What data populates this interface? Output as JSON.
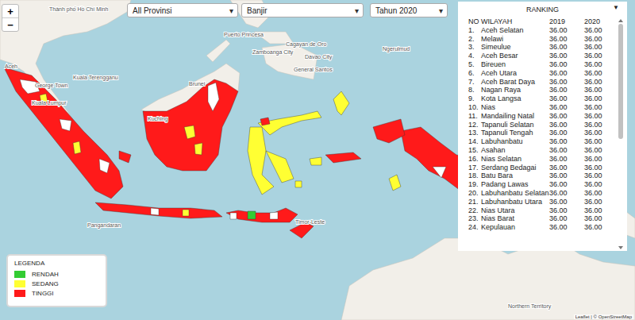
{
  "zoom": [
    "+",
    "−"
  ],
  "filters": [
    {
      "label": "All Provinsi",
      "caret": "▾"
    },
    {
      "label": "Banjir",
      "caret": "▾"
    },
    {
      "label": "Tahun 2020",
      "caret": "▾"
    }
  ],
  "ranking": {
    "title": "RANKING",
    "toggle": "▼",
    "columns": [
      "NO",
      "WILAYAH",
      "2019",
      "2020"
    ],
    "scroll": {
      "level": 0.5
    },
    "rows": [
      {
        "no": "1.",
        "name": "Aceh Selatan",
        "y2019": "36.00",
        "y2020": "36.00"
      },
      {
        "no": "2.",
        "name": "Melawi",
        "y2019": "36.00",
        "y2020": "36.00"
      },
      {
        "no": "3.",
        "name": "Simeulue",
        "y2019": "36.00",
        "y2020": "36.00"
      },
      {
        "no": "4.",
        "name": "Aceh Besar",
        "y2019": "36.00",
        "y2020": "36.00"
      },
      {
        "no": "5.",
        "name": "Bireuen",
        "y2019": "36.00",
        "y2020": "36.00"
      },
      {
        "no": "6.",
        "name": "Aceh Utara",
        "y2019": "36.00",
        "y2020": "36.00"
      },
      {
        "no": "7.",
        "name": "Aceh Barat Daya",
        "y2019": "36.00",
        "y2020": "36.00"
      },
      {
        "no": "8.",
        "name": "Nagan Raya",
        "y2019": "36.00",
        "y2020": "36.00"
      },
      {
        "no": "9.",
        "name": "Kota Langsa",
        "y2019": "36.00",
        "y2020": "36.00"
      },
      {
        "no": "10.",
        "name": "Nias",
        "y2019": "36.00",
        "y2020": "36.00"
      },
      {
        "no": "11.",
        "name": "Mandailing Natal",
        "y2019": "36.00",
        "y2020": "36.00"
      },
      {
        "no": "12.",
        "name": "Tapanuli Selatan",
        "y2019": "36.00",
        "y2020": "36.00"
      },
      {
        "no": "13.",
        "name": "Tapanuli Tengah",
        "y2019": "36.00",
        "y2020": "36.00"
      },
      {
        "no": "14.",
        "name": "Labuhanbatu",
        "y2019": "36.00",
        "y2020": "36.00"
      },
      {
        "no": "15.",
        "name": "Asahan",
        "y2019": "36.00",
        "y2020": "36.00"
      },
      {
        "no": "16.",
        "name": "Nias Selatan",
        "y2019": "36.00",
        "y2020": "36.00"
      },
      {
        "no": "17.",
        "name": "Serdang Bedagai",
        "y2019": "36.00",
        "y2020": "36.00"
      },
      {
        "no": "18.",
        "name": "Batu Bara",
        "y2019": "36.00",
        "y2020": "36.00"
      },
      {
        "no": "19.",
        "name": "Padang Lawas",
        "y2019": "36.00",
        "y2020": "36.00"
      },
      {
        "no": "20.",
        "name": "Labuhanbatu Selatan",
        "y2019": "36.00",
        "y2020": "36.00"
      },
      {
        "no": "21.",
        "name": "Labuhanbatu Utara",
        "y2019": "36.00",
        "y2020": "36.00"
      },
      {
        "no": "22.",
        "name": "Nias Utara",
        "y2019": "36.00",
        "y2020": "36.00"
      },
      {
        "no": "23.",
        "name": "Nias Barat",
        "y2019": "36.00",
        "y2020": "36.00"
      },
      {
        "no": "24.",
        "name": "Kepulauan",
        "y2019": "36.00",
        "y2020": "36.00"
      }
    ]
  },
  "legend": {
    "title": "LEGENDA",
    "items": [
      {
        "label": "RENDAH",
        "color": "#33cc33"
      },
      {
        "label": "SEDANG",
        "color": "#ffff33"
      },
      {
        "label": "TINGGI",
        "color": "#ff1a1a"
      }
    ]
  },
  "map": {
    "labels": [
      "Thành phố Hồ Chí Minh",
      "Aceh",
      "George Town",
      "Kuala Terengganu",
      "Kuala Lumpur",
      "Brunei",
      "Kuching",
      "Puerto Princesa",
      "Zamboanga City",
      "Cagayan de Oro",
      "Davao City",
      "General Santos",
      "Ngerulmud",
      "Pangandaran",
      "Timor-Leste",
      "Northern Territory"
    ],
    "regions": [
      {
        "category": "TINGGI"
      },
      {
        "category": "KOSONG"
      },
      {
        "category": "SEDANG"
      },
      {
        "category": "KOSONG"
      },
      {
        "category": "SEDANG"
      },
      {
        "category": "KOSONG"
      },
      {
        "category": "TINGGI"
      },
      {
        "category": "TINGGI"
      },
      {
        "category": "KOSONG"
      },
      {
        "category": "SEDANG"
      },
      {
        "category": "SEDANG"
      },
      {
        "category": "TINGGI"
      },
      {
        "category": "KOSONG"
      },
      {
        "category": "SEDANG"
      },
      {
        "category": "TINGGI"
      },
      {
        "category": "RENDAH"
      },
      {
        "category": "KOSONG"
      },
      {
        "category": "KOSONG"
      },
      {
        "category": "SEDANG"
      },
      {
        "category": "SEDANG"
      },
      {
        "category": "SEDANG"
      },
      {
        "category": "TINGGI"
      },
      {
        "category": "SEDANG"
      },
      {
        "category": "TINGGI"
      },
      {
        "category": "SEDANG"
      },
      {
        "category": "SEDANG"
      },
      {
        "category": "TINGGI"
      },
      {
        "category": "TINGGI"
      },
      {
        "category": "KOSONG"
      },
      {
        "category": "KOSONG"
      },
      {
        "category": "TINGGI"
      },
      {
        "category": "SEDANG"
      }
    ]
  },
  "attribution": "Leaflet | © OpenStreetMap"
}
